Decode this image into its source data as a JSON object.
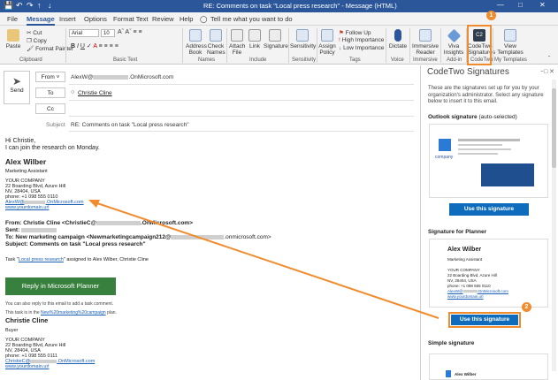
{
  "window": {
    "title": "RE: Comments on task \"Local press research\" - Message (HTML)"
  },
  "menu": {
    "items": [
      "File",
      "Message",
      "Insert",
      "Options",
      "Format Text",
      "Review",
      "Help"
    ],
    "active": "Message",
    "tell_me": "Tell me what you want to do"
  },
  "ribbon": {
    "paste": "Paste",
    "cut": "Cut",
    "copy": "Copy",
    "format_painter": "Format Painter",
    "clipboard": "Clipboard",
    "font": "Arial",
    "font_size": "10",
    "basic_text": "Basic Text",
    "address_book": "Address Book",
    "check_names": "Check Names",
    "names": "Names",
    "attach_file": "Attach File",
    "link": "Link",
    "signature": "Signature",
    "include": "Include",
    "sensitivity": "Sensitivity",
    "assign_policy": "Assign Policy",
    "follow_up": "Follow Up",
    "high_importance": "High Importance",
    "low_importance": "Low Importance",
    "tags": "Tags",
    "dictate": "Dictate",
    "voice": "Voice",
    "immersive_reader": "Immersive Reader",
    "immersive": "Immersive",
    "viva_insights": "Viva Insights",
    "add_in": "Add-in",
    "codetwo_signatures": "CodeTwo Signatures",
    "codetwo": "CodeTwo",
    "view_templates": "View Templates",
    "my_templates": "My Templates",
    "step1": "1"
  },
  "compose": {
    "send": "Send",
    "from_label": "From",
    "from_value": "AlexW@",
    "from_domain": ".OnMicrosoft.com",
    "to_label": "To",
    "to_value": "Christie Cline",
    "cc_label": "Cc",
    "subject_label": "Subject",
    "subject_value": "RE: Comments on task \"Local press research\""
  },
  "body": {
    "greeting": "Hi Christie,",
    "line1": "I can join the research on Monday.",
    "sig_name": "Alex Wilber",
    "sig_title": "Marketing Assistant",
    "sig_company": "YOUR COMPANY",
    "sig_addr1": "22 Boarding Blvd, Azure Hill",
    "sig_addr2": "NV, 28404, USA",
    "sig_phone": "phone: +1 098 555 0110",
    "sig_email": "AlexW@",
    "sig_email_domain": ".OnMicrosoft.com",
    "sig_web": "www.yourdomain.url",
    "from_line": "From: Christie Cline <ChristieC@",
    "from_line_end": ".OnMicrosoft.com>",
    "sent_line": "Sent:",
    "to_line": "To: New marketing campaign <Newmarketingcampaign212@",
    "to_line_end": ".onmicrosoft.com>",
    "subject_line": "Subject: Comments on task \"Local press research\"",
    "task_prefix": "Task \"",
    "task_link": "Local press research",
    "task_suffix": "\" assigned to Alex Wilber, Christie Cline",
    "planner_button": "Reply in Microsoft Planner",
    "reply_note": "You can also reply to this email to add a task comment.",
    "task_in": "This task is in the",
    "task_in_link": "New%20marketing%20campaign",
    "task_in_end": "plan.",
    "sig2_name": "Christie Cline",
    "sig2_title": "Buyer",
    "sig2_company": "YOUR COMPANY",
    "sig2_addr1": "22 Boarding Blvd, Azure Hill",
    "sig2_addr2": "NV, 28404, USA",
    "sig2_phone": "phone: +1 098 555 0111",
    "sig2_email": "ChristieC@",
    "sig2_email_domain": ".OnMicrosoft.com",
    "sig2_web": "www.yourdomain.url"
  },
  "panel": {
    "title": "CodeTwo Signatures",
    "intro": "These are the signatures set up for you by your organization's administrator. Select any signature below to insert it to this email.",
    "outlook_sig_label": "Outlook signature",
    "auto_selected": "(auto-selected)",
    "use_button_1": "Use this signature",
    "planner_sig_label": "Signature for Planner",
    "card_name": "Alex Wilber",
    "card_title": "Marketing Assistant",
    "card_company": "YOUR COMPANY",
    "card_addr1": "22 Boarding Blvd, Azure Hill",
    "card_addr2": "NV, 28404, USA",
    "card_phone": "phone: +1 098 555 0110",
    "card_email": "AlexW@",
    "card_email_domain": ".OnMicrosoft.com",
    "card_web": "www.yourdomain.url",
    "use_button_2": "Use this signature",
    "step2": "2",
    "simple_sig_label": "Simple signature",
    "simple_card_name": "Alex Wilber",
    "company_logo_text": "company"
  },
  "colors": {
    "accent": "#2b579a",
    "orange": "#f08c2e",
    "planner_green": "#38803e",
    "button_blue": "#0f6cbd"
  }
}
